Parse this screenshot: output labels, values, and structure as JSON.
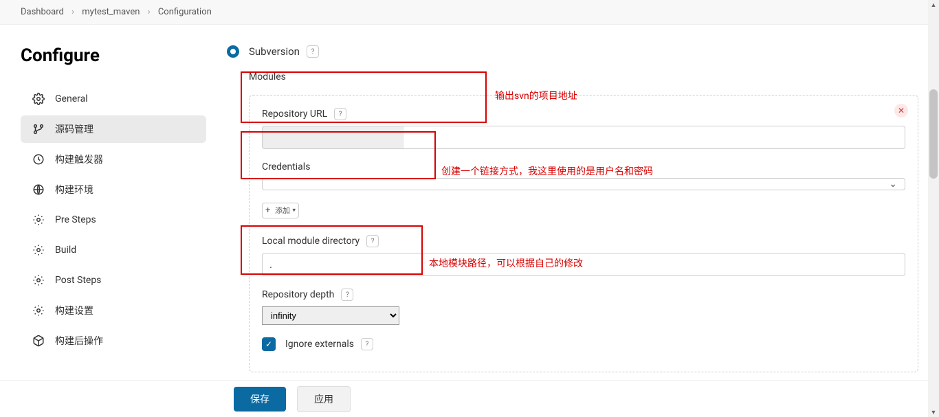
{
  "breadcrumb": [
    "Dashboard",
    "mytest_maven",
    "Configuration"
  ],
  "page_title": "Configure",
  "sidebar": {
    "items": [
      {
        "label": "General",
        "icon": "gear",
        "active": false
      },
      {
        "label": "源码管理",
        "icon": "branch",
        "active": true
      },
      {
        "label": "构建触发器",
        "icon": "clock",
        "active": false
      },
      {
        "label": "构建环境",
        "icon": "globe",
        "active": false
      },
      {
        "label": "Pre Steps",
        "icon": "gear",
        "active": false
      },
      {
        "label": "Build",
        "icon": "gear",
        "active": false
      },
      {
        "label": "Post Steps",
        "icon": "gear",
        "active": false
      },
      {
        "label": "构建设置",
        "icon": "gear",
        "active": false
      },
      {
        "label": "构建后操作",
        "icon": "box",
        "active": false
      }
    ]
  },
  "scm": {
    "selected_label": "Subversion",
    "modules_label": "Modules",
    "repo_url_label": "Repository URL",
    "repo_url_value": "",
    "credentials_label": "Credentials",
    "credentials_value": "",
    "add_label": "添加",
    "local_dir_label": "Local module directory",
    "local_dir_value": ".",
    "depth_label": "Repository depth",
    "depth_value": "infinity",
    "ignore_externals_label": "Ignore externals"
  },
  "annotations": {
    "repo": "输出svn的项目地址",
    "cred": "创建一个链接方式，我这里使用的是用户名和密码",
    "local": "本地模块路径，可以根据自己的修改"
  },
  "footer": {
    "save": "保存",
    "apply": "应用"
  }
}
